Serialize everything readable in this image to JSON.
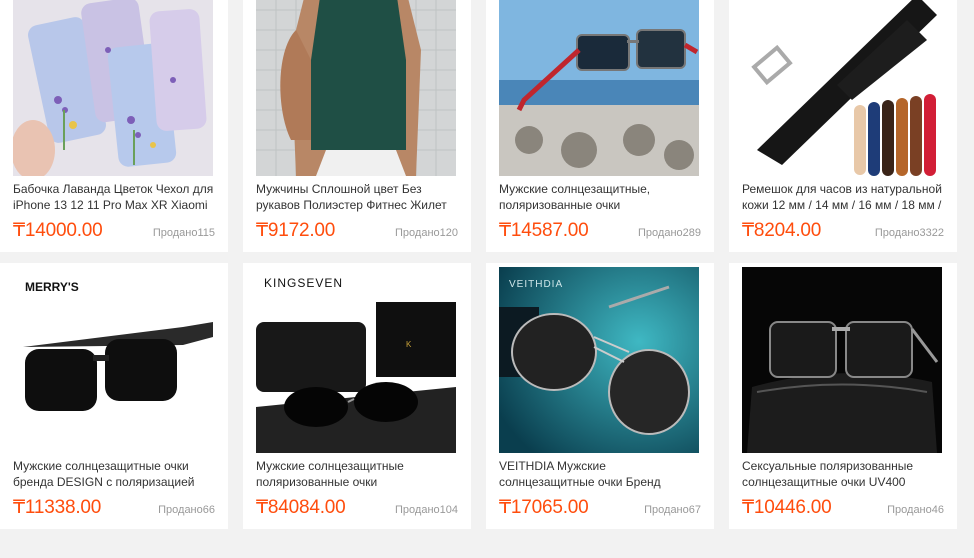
{
  "currency_symbol": "₸",
  "products": [
    {
      "image": "phone-case-lavender-image",
      "title": "Бабочка Лаванда Цветок Чехол для iPhone 13 12 11 Pro Max XR Xiaomi",
      "price": "₸14000.00",
      "sold": "Продано115"
    },
    {
      "image": "mens-fitness-vest-image",
      "title": "Мужчины Сплошной цвет Без рукавов Полиэстер Фитнес Жилет Топ",
      "price": "₸9172.00",
      "sold": "Продано120"
    },
    {
      "image": "polarized-sunglasses-red-image",
      "title": "Мужские солнцезащитные, поляризованные очки",
      "price": "₸14587.00",
      "sold": "Продано289"
    },
    {
      "image": "leather-watch-strap-image",
      "title": "Ремешок для часов из натуральной кожи 12 мм / 14 мм / 16 мм / 18 мм /",
      "price": "₸8204.00",
      "sold": "Продано3322"
    },
    {
      "image": "merrys-sunglasses-image",
      "image_text": "MERRY'S",
      "title": "Мужские солнцезащитные очки бренда DESIGN с поляризацией",
      "price": "₸11338.00",
      "sold": "Продано66"
    },
    {
      "image": "kingseven-sunglasses-image",
      "image_text": "KINGSEVEN",
      "title": "Мужские солнцезащитные поляризованные очки",
      "price": "₸84084.00",
      "sold": "Продано104"
    },
    {
      "image": "veithdia-pilot-sunglasses-image",
      "image_text": "VEITHDIA",
      "title": "VEITHDIA Мужские солнцезащитные очки Бренд Дизайнер Пилот",
      "price": "₸17065.00",
      "sold": "Продано67"
    },
    {
      "image": "uv400-sunglasses-image",
      "title": "Сексуальные поляризованные солнцезащитные очки UV400",
      "price": "₸10446.00",
      "sold": "Продано46"
    }
  ]
}
